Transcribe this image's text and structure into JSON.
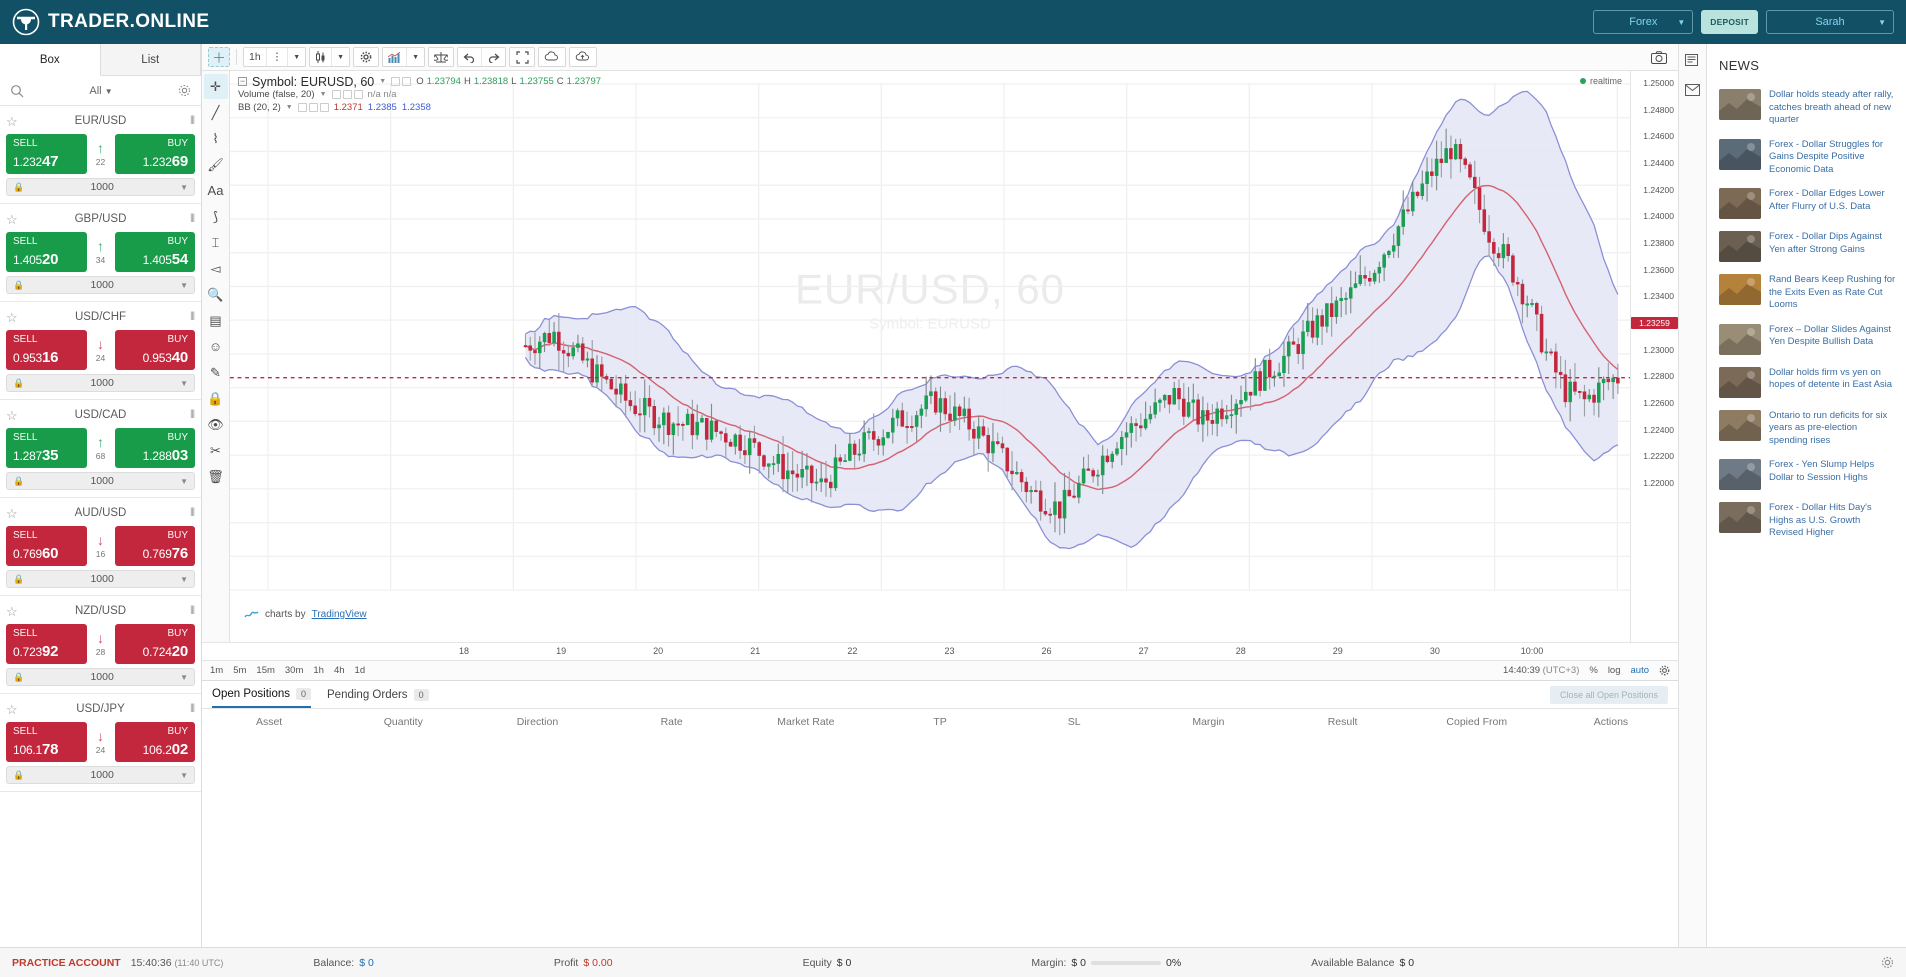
{
  "brand": {
    "name": "TRADER.ONLINE",
    "logo_icon": "trader-online-logo"
  },
  "topbar": {
    "market_selector": "Forex",
    "deposit_label": "DEPOSIT",
    "user_name": "Sarah"
  },
  "sidebar": {
    "tabs": [
      {
        "label": "Box",
        "active": true
      },
      {
        "label": "List",
        "active": false
      }
    ],
    "filter": {
      "search_icon": "search-icon",
      "all_label": "All",
      "settings_icon": "gear-icon"
    },
    "pairs": [
      {
        "name": "EUR/USD",
        "sell_label": "SELL",
        "buy_label": "BUY",
        "sell_price_pre": "1.232",
        "sell_price_big": "47",
        "buy_price_pre": "1.232",
        "buy_price_big": "69",
        "spread": "22",
        "direction": "up",
        "sell_color": "green",
        "buy_color": "green",
        "quantity": "1000"
      },
      {
        "name": "GBP/USD",
        "sell_label": "SELL",
        "buy_label": "BUY",
        "sell_price_pre": "1.405",
        "sell_price_big": "20",
        "buy_price_pre": "1.405",
        "buy_price_big": "54",
        "spread": "34",
        "direction": "up",
        "sell_color": "green",
        "buy_color": "green",
        "quantity": "1000"
      },
      {
        "name": "USD/CHF",
        "sell_label": "SELL",
        "buy_label": "BUY",
        "sell_price_pre": "0.953",
        "sell_price_big": "16",
        "buy_price_pre": "0.953",
        "buy_price_big": "40",
        "spread": "24",
        "direction": "down",
        "sell_color": "red",
        "buy_color": "red",
        "quantity": "1000"
      },
      {
        "name": "USD/CAD",
        "sell_label": "SELL",
        "buy_label": "BUY",
        "sell_price_pre": "1.287",
        "sell_price_big": "35",
        "buy_price_pre": "1.288",
        "buy_price_big": "03",
        "spread": "68",
        "direction": "up",
        "sell_color": "green",
        "buy_color": "green",
        "quantity": "1000"
      },
      {
        "name": "AUD/USD",
        "sell_label": "SELL",
        "buy_label": "BUY",
        "sell_price_pre": "0.769",
        "sell_price_big": "60",
        "buy_price_pre": "0.769",
        "buy_price_big": "76",
        "spread": "16",
        "direction": "down",
        "sell_color": "red",
        "buy_color": "red",
        "quantity": "1000"
      },
      {
        "name": "NZD/USD",
        "sell_label": "SELL",
        "buy_label": "BUY",
        "sell_price_pre": "0.723",
        "sell_price_big": "92",
        "buy_price_pre": "0.724",
        "buy_price_big": "20",
        "spread": "28",
        "direction": "down",
        "sell_color": "red",
        "buy_color": "red",
        "quantity": "1000"
      },
      {
        "name": "USD/JPY",
        "sell_label": "SELL",
        "buy_label": "BUY",
        "sell_price_pre": "106.1",
        "sell_price_big": "78",
        "buy_price_pre": "106.2",
        "buy_price_big": "02",
        "spread": "24",
        "direction": "down",
        "sell_color": "red",
        "buy_color": "red",
        "quantity": "1000"
      }
    ]
  },
  "chart": {
    "toolbar": {
      "interval": "1h",
      "crosshair_icon": "crosshair-icon",
      "more_icon": "dots-vertical-icon",
      "candle_icon": "candlestick-icon",
      "settings_icon": "gear-icon",
      "indicators_icon": "indicators-icon",
      "compare_icon": "compare-scales-icon",
      "undo_icon": "undo-icon",
      "redo_icon": "redo-icon",
      "fullscreen_icon": "fullscreen-icon",
      "load_icon": "cloud-download-icon",
      "save_icon": "cloud-upload-icon",
      "camera_icon": "camera-icon"
    },
    "draw_tools": [
      "crosshair-tool-icon",
      "trendline-tool-icon",
      "fib-tool-icon",
      "brush-tool-icon",
      "text-tool-icon",
      "shapes-tool-icon",
      "measure-tool-icon",
      "arrow-tool-icon",
      "zoom-tool-icon",
      "ruler-tool-icon",
      "magnet-tool-icon",
      "highlighter-tool-icon",
      "lock-tool-icon",
      "hide-tool-icon",
      "cut-tool-icon",
      "trash-tool-icon"
    ],
    "legend": {
      "symbol_label": "Symbol: EURUSD, 60",
      "volume_label": "Volume (false, 20)",
      "volume_values": "n/a  n/a",
      "bb_label": "BB (20, 2)",
      "bb_values": [
        "1.2371",
        "1.2385",
        "1.2358"
      ],
      "ohlc": [
        {
          "k": "O",
          "v": "1.23794"
        },
        {
          "k": "H",
          "v": "1.23818"
        },
        {
          "k": "L",
          "v": "1.23755"
        },
        {
          "k": "C",
          "v": "1.23797"
        }
      ],
      "realtime_label": "realtime"
    },
    "watermark": {
      "line1": "EUR/USD, 60",
      "line2": "Symbol: EURUSD"
    },
    "credit": {
      "prefix": "charts by",
      "link": "TradingView",
      "icon": "tradingview-icon"
    },
    "current_price": "1.23259",
    "price_ticks": [
      "1.25000",
      "1.24800",
      "1.24600",
      "1.24400",
      "1.24200",
      "1.24000",
      "1.23800",
      "1.23600",
      "1.23400",
      "1.23200",
      "1.23000",
      "1.22800",
      "1.22600",
      "1.22400",
      "1.22200",
      "1.22000"
    ],
    "time_ticks": [
      "18",
      "19",
      "20",
      "21",
      "22",
      "23",
      "26",
      "27",
      "28",
      "29",
      "30",
      "10:00"
    ],
    "footer": {
      "intervals": [
        "1m",
        "5m",
        "15m",
        "30m",
        "1h",
        "4h",
        "1d"
      ],
      "active_interval": "1h",
      "clock": "14:40:39",
      "timezone": "(UTC+3)",
      "percent_label": "%",
      "log_label": "log",
      "auto_label": "auto",
      "settings_icon": "gear-icon"
    }
  },
  "chart_data": {
    "type": "line",
    "title": "EURUSD 60",
    "ylim": [
      1.22,
      1.25
    ],
    "note": "Candlestick chart with Bollinger Bands (20,2) overlay"
  },
  "positions": {
    "tabs": [
      {
        "label": "Open Positions",
        "count": "0",
        "active": true
      },
      {
        "label": "Pending Orders",
        "count": "0",
        "active": false
      }
    ],
    "close_all_label": "Close all Open Positions",
    "columns": [
      "Asset",
      "Quantity",
      "Direction",
      "Rate",
      "Market Rate",
      "TP",
      "SL",
      "Margin",
      "Result",
      "Copied From",
      "Actions"
    ]
  },
  "rightbar": {
    "icons": [
      "news-panel-icon",
      "mail-panel-icon"
    ]
  },
  "news": {
    "title": "NEWS",
    "items": [
      {
        "text": "Dollar holds steady after rally, catches breath ahead of new quarter"
      },
      {
        "text": "Forex - Dollar Struggles for Gains Despite Positive Economic Data"
      },
      {
        "text": "Forex - Dollar Edges Lower After Flurry of U.S. Data"
      },
      {
        "text": "Forex - Dollar Dips Against Yen after Strong Gains"
      },
      {
        "text": "Rand Bears Keep Rushing for the Exits Even as Rate Cut Looms"
      },
      {
        "text": "Forex – Dollar Slides Against Yen Despite Bullish Data"
      },
      {
        "text": "Dollar holds firm vs yen on hopes of detente in East Asia"
      },
      {
        "text": "Ontario to run deficits for six years as pre-election spending rises"
      },
      {
        "text": "Forex - Yen Slump Helps Dollar to Session Highs"
      },
      {
        "text": "Forex - Dollar Hits Day's Highs as U.S. Growth Revised Higher"
      }
    ]
  },
  "statusbar": {
    "account_type": "PRACTICE ACCOUNT",
    "time": "15:40:36",
    "time_utc": "(11:40 UTC)",
    "balance_label": "Balance:",
    "balance_value": "$ 0",
    "profit_label": "Profit",
    "profit_value": "$ 0.00",
    "equity_label": "Equity",
    "equity_value": "$ 0",
    "margin_label": "Margin:",
    "margin_value": "$ 0",
    "margin_percent": "0%",
    "available_label": "Available Balance",
    "available_value": "$ 0",
    "settings_icon": "gear-icon"
  },
  "colors": {
    "brand_dark": "#125066",
    "buy_green": "#189c4a",
    "sell_red": "#c2273d",
    "accent_blue": "#1f6fb2",
    "deposit_bg": "#b9e3dc"
  }
}
